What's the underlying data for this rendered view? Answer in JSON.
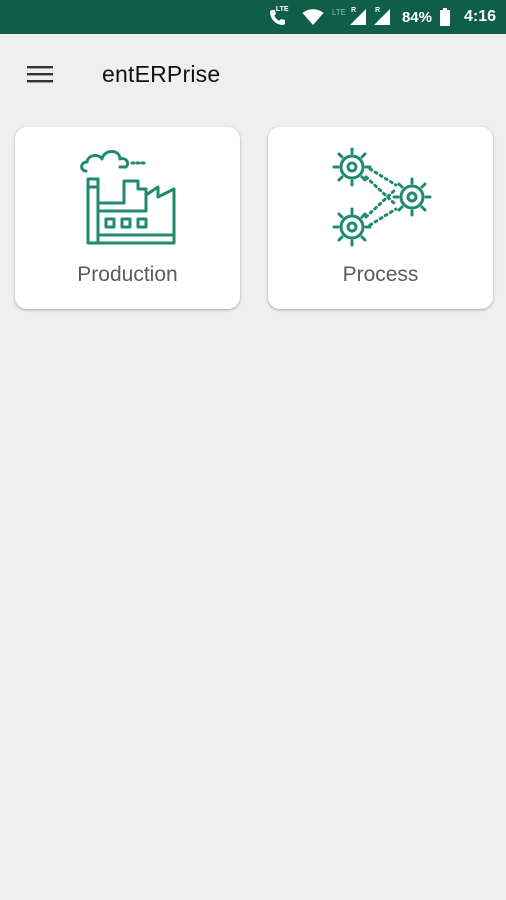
{
  "status_bar": {
    "lte_call_tag": "LTE",
    "lte_label": "LTE",
    "signal1_tag": "R",
    "signal2_tag": "R",
    "battery": "84%",
    "time": "4:16",
    "icons": [
      "lte-call-icon",
      "wifi-icon",
      "signal-icon",
      "signal-icon",
      "battery-icon"
    ]
  },
  "app_bar": {
    "title": "entERPrise",
    "menu_icon": "hamburger-menu-icon"
  },
  "cards": [
    {
      "label": "Production",
      "icon": "factory-icon"
    },
    {
      "label": "Process",
      "icon": "gears-process-icon"
    }
  ],
  "colors": {
    "status_bar": "#0f5e48",
    "icon_accent": "#1f8a6e",
    "background": "#efefef",
    "card": "#ffffff"
  }
}
